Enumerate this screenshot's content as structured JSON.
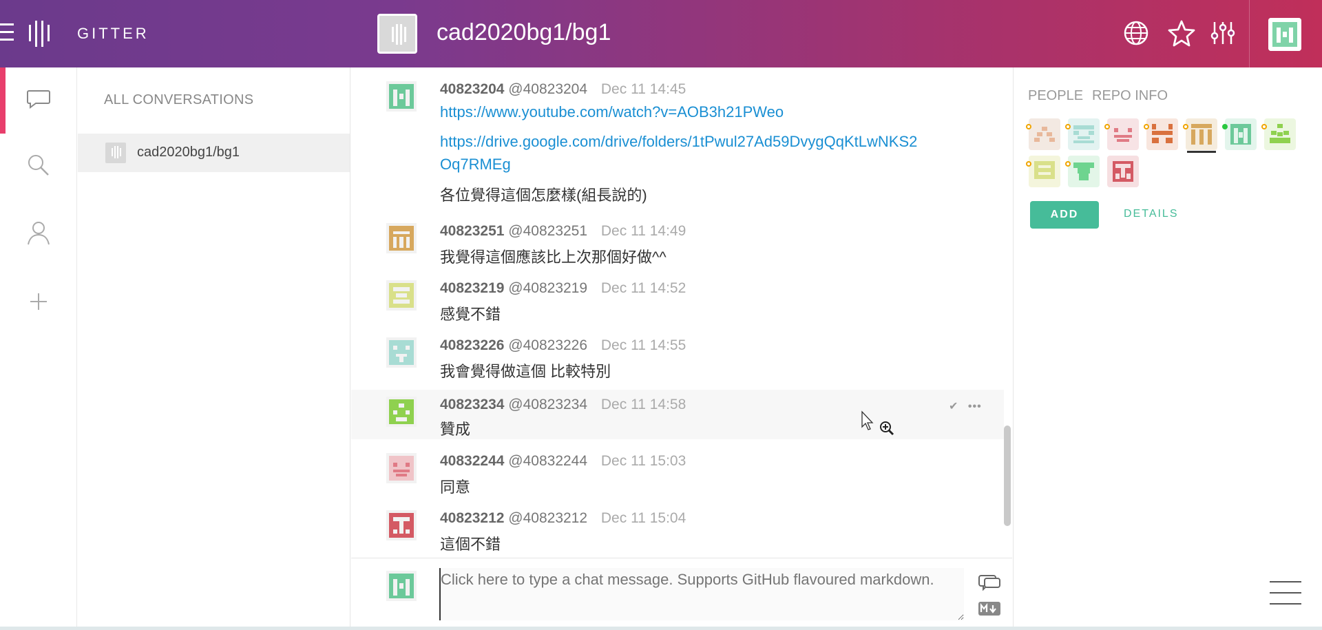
{
  "header": {
    "brand": "GITTER",
    "room_title": "cad2020bg1/bg1"
  },
  "conversations": {
    "title": "ALL CONVERSATIONS",
    "items": [
      {
        "label": "cad2020bg1/bg1"
      }
    ]
  },
  "messages": [
    {
      "display_name": "40823204",
      "username": "@40823204",
      "time": "Dec 11 14:45",
      "lines": [
        "https://www.youtube.com/watch?v=AOB3h21PWeo",
        "https://drive.google.com/drive/folders/1tPwul27Ad59DvygQqKtLwNKS2",
        "Oq7RMEg",
        "各位覺得這個怎麼樣(組長說的)"
      ]
    },
    {
      "display_name": "40823251",
      "username": "@40823251",
      "time": "Dec 11 14:49",
      "lines": [
        "我覺得這個應該比上次那個好做^^"
      ]
    },
    {
      "display_name": "40823219",
      "username": "@40823219",
      "time": "Dec 11 14:52",
      "lines": [
        "感覺不錯"
      ]
    },
    {
      "display_name": "40823226",
      "username": "@40823226",
      "time": "Dec 11 14:55",
      "lines": [
        "我會覺得做這個 比較特別"
      ]
    },
    {
      "display_name": "40823234",
      "username": "@40823234",
      "time": "Dec 11 14:58",
      "lines": [
        "贊成"
      ]
    },
    {
      "display_name": "40832244",
      "username": "@40832244",
      "time": "Dec 11 15:03",
      "lines": [
        "同意"
      ]
    },
    {
      "display_name": "40823212",
      "username": "@40823212",
      "time": "Dec 11 15:04",
      "lines": [
        "這個不錯"
      ]
    }
  ],
  "composer": {
    "placeholder": "Click here to type a chat message. Supports GitHub flavoured markdown."
  },
  "right_panel": {
    "tabs": [
      "PEOPLE",
      "REPO INFO"
    ],
    "add_label": "ADD",
    "details_label": "DETAILS"
  },
  "colors": {
    "accent_green": "#46bc99",
    "link_blue": "#1a8fd3",
    "active_pink": "#e83e6c"
  }
}
